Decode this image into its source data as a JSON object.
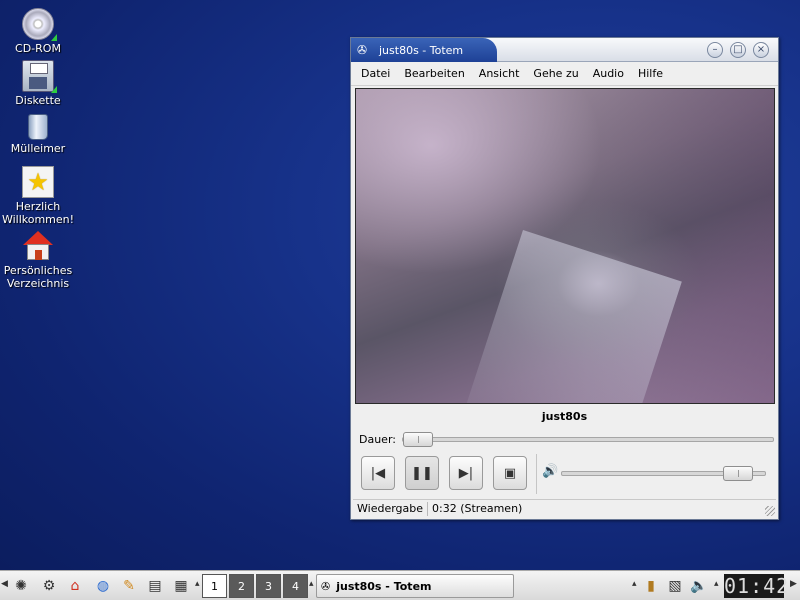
{
  "desktop": {
    "icons": [
      {
        "label": "CD-ROM",
        "icon": "cdrom-icon"
      },
      {
        "label": "Diskette",
        "icon": "floppy-icon"
      },
      {
        "label": "Mülleimer",
        "icon": "trash-icon"
      },
      {
        "label": "Herzlich\nWillkommen!",
        "icon": "welcome-star-icon"
      },
      {
        "label": "Persönliches\nVerzeichnis",
        "icon": "home-folder-icon"
      }
    ]
  },
  "window": {
    "title": "just80s - Totem",
    "menu": [
      "Datei",
      "Bearbeiten",
      "Ansicht",
      "Gehe zu",
      "Audio",
      "Hilfe"
    ],
    "stream_title": "just80s",
    "seek_label": "Dauer:",
    "seek_position": 0.0,
    "volume_level": 0.93,
    "status_state": "Wiedergabe",
    "status_time": "0:32 (Streamen)"
  },
  "panel": {
    "pager": [
      "1",
      "2",
      "3",
      "4"
    ],
    "active_desktop": "1",
    "task_title": "just80s - Totem",
    "clock": "01:42"
  },
  "colors": {
    "desktop_bg": "#17328a",
    "title_accent": "#2a52a8"
  }
}
